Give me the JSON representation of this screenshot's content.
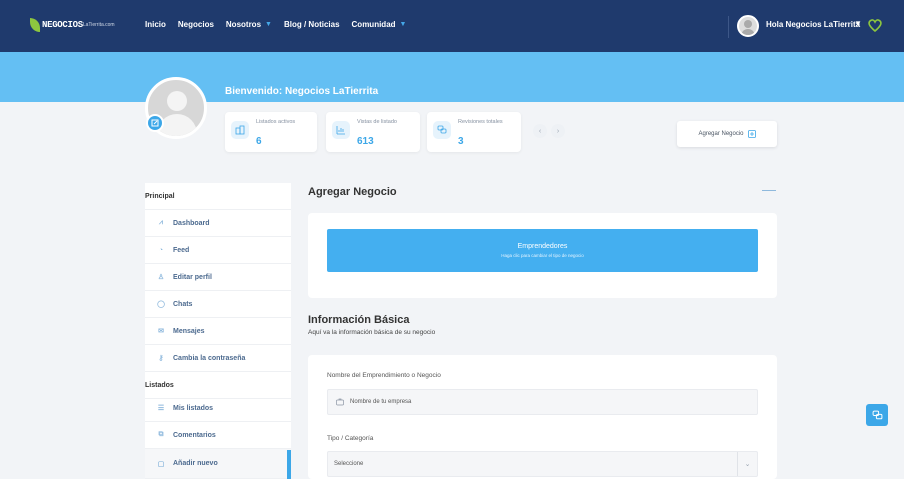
{
  "brand": {
    "logo_text": "NEGOCIOS",
    "logo_sub": "LaTierrita.com"
  },
  "nav": {
    "items": [
      {
        "label": "Inicio",
        "has_caret": false
      },
      {
        "label": "Negocios",
        "has_caret": false
      },
      {
        "label": "Nosotros",
        "has_caret": true
      },
      {
        "label": "Blog / Noticias",
        "has_caret": false
      },
      {
        "label": "Comunidad",
        "has_caret": true
      }
    ],
    "caret": "▼",
    "user_greeting": "Hola Negocios LaTierrita",
    "user_caret": "▼"
  },
  "profile": {
    "welcome": "Bienvenido: Negocios LaTierrita"
  },
  "stats": [
    {
      "label": "Listados activos",
      "value": "6",
      "icon": "buildings-icon"
    },
    {
      "label": "Vistas de listado",
      "value": "613",
      "icon": "chart-icon"
    },
    {
      "label": "Revisiones totales",
      "value": "3",
      "icon": "chat-bubbles-icon"
    }
  ],
  "pager": {
    "prev": "‹",
    "next": "›"
  },
  "add_button": {
    "label": "Agregar Negocio"
  },
  "sidebar": {
    "sections": [
      {
        "heading": "Principal"
      },
      {
        "heading": "Listados"
      }
    ],
    "items": [
      {
        "label": "Dashboard",
        "icon": "chart-line-icon",
        "glyph": "⩘"
      },
      {
        "label": "Feed",
        "icon": "rss-icon",
        "glyph": "◔"
      },
      {
        "label": "Editar perfil",
        "icon": "user-edit-icon",
        "glyph": "♙"
      },
      {
        "label": "Chats",
        "icon": "chat-icon",
        "glyph": "◯"
      },
      {
        "label": "Mensajes",
        "icon": "envelope-icon",
        "glyph": "✉"
      },
      {
        "label": "Cambia la contraseña",
        "icon": "key-icon",
        "glyph": "⚷"
      },
      {
        "label": "Mis listados",
        "icon": "list-icon",
        "glyph": "☰"
      },
      {
        "label": "Comentarios",
        "icon": "comments-icon",
        "glyph": "⧉"
      },
      {
        "label": "Añadir nuevo",
        "icon": "add-file-icon",
        "glyph": "▢"
      }
    ]
  },
  "main": {
    "page_title": "Agregar Negocio",
    "type_button": {
      "title": "Emprendedores",
      "subtitle": "Haga clic para cambiar el tipo de negocio"
    },
    "section_title": "Información Básica",
    "section_subtitle": "Aquí va la información básica de su negocio",
    "fields": {
      "name": {
        "label": "Nombre del Emprendimiento o Negocio",
        "placeholder": "Nombre de tu empresa"
      },
      "category": {
        "label": "Tipo / Categoría",
        "selected": "Seleccione"
      }
    }
  },
  "colors": {
    "nav_bg": "#1f3a6d",
    "banner": "#64bff3",
    "accent": "#3ca7e8",
    "page_bg": "#f2f4f7"
  }
}
